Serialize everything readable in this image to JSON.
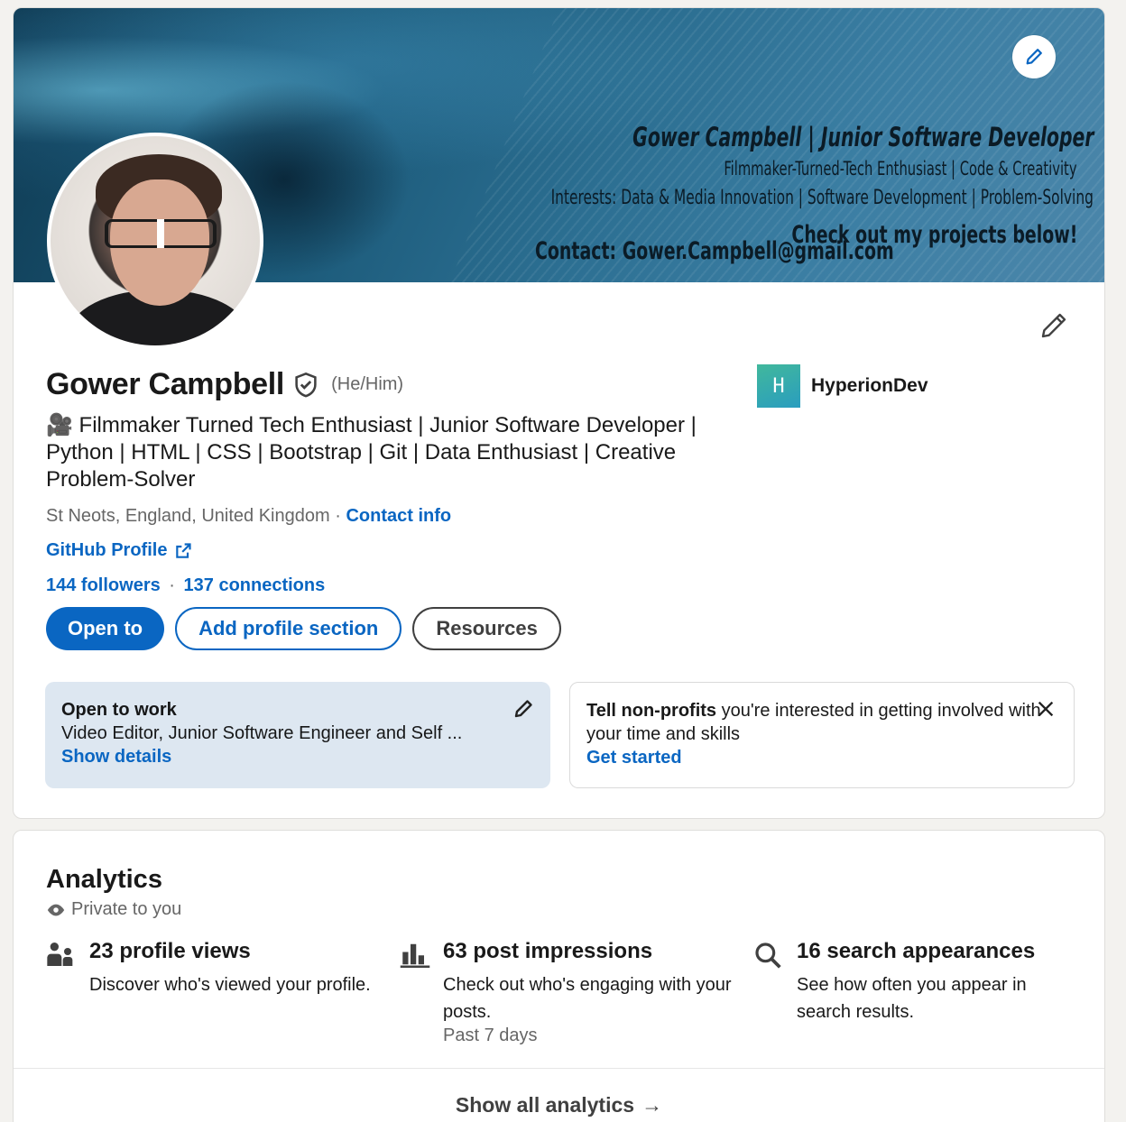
{
  "banner": {
    "line1": "Gower Campbell | Junior Software Developer",
    "line2": "Filmmaker-Turned-Tech Enthusiast | Code & Creativity",
    "line3": "Interests: Data & Media Innovation | Software Development | Problem-Solving",
    "line4": "Check out my projects below!",
    "contact": "Contact: Gower.Campbell@gmail.com"
  },
  "profile": {
    "name": "Gower Campbell",
    "pronouns": "(He/Him)",
    "headline": "🎥 Filmmaker Turned Tech Enthusiast | Junior Software Developer | Python | HTML | CSS | Bootstrap | Git | Data Enthusiast | Creative Problem-Solver",
    "location": "St Neots, England, United Kingdom",
    "separator": "·",
    "contact_info": "Contact info",
    "github": "GitHub Profile",
    "followers": "144 followers",
    "connections": "137 connections"
  },
  "company": {
    "logo_text": "H",
    "name": "HyperionDev"
  },
  "actions": {
    "open_to": "Open to",
    "add_section": "Add profile section",
    "resources": "Resources"
  },
  "open_to_work": {
    "title": "Open to work",
    "roles": "Video Editor, Junior Software Engineer and Self ...",
    "link": "Show details"
  },
  "nonprofit": {
    "bold": "Tell non-profits",
    "text": " you're interested in getting involved with your time and skills",
    "link": "Get started"
  },
  "analytics": {
    "title": "Analytics",
    "private": "Private to you",
    "metrics": [
      {
        "icon": "people-icon",
        "title": "23 profile views",
        "desc": "Discover who's viewed your profile.",
        "sub": ""
      },
      {
        "icon": "bar-chart-icon",
        "title": "63 post impressions",
        "desc": "Check out who's engaging with your posts.",
        "sub": "Past 7 days"
      },
      {
        "icon": "search-icon",
        "title": "16 search appearances",
        "desc": "See how often you appear in search results.",
        "sub": ""
      }
    ],
    "footer": "Show all analytics",
    "footer_arrow": "→"
  },
  "colors": {
    "link": "#0a66c2",
    "otw_bg": "#dde7f1"
  }
}
